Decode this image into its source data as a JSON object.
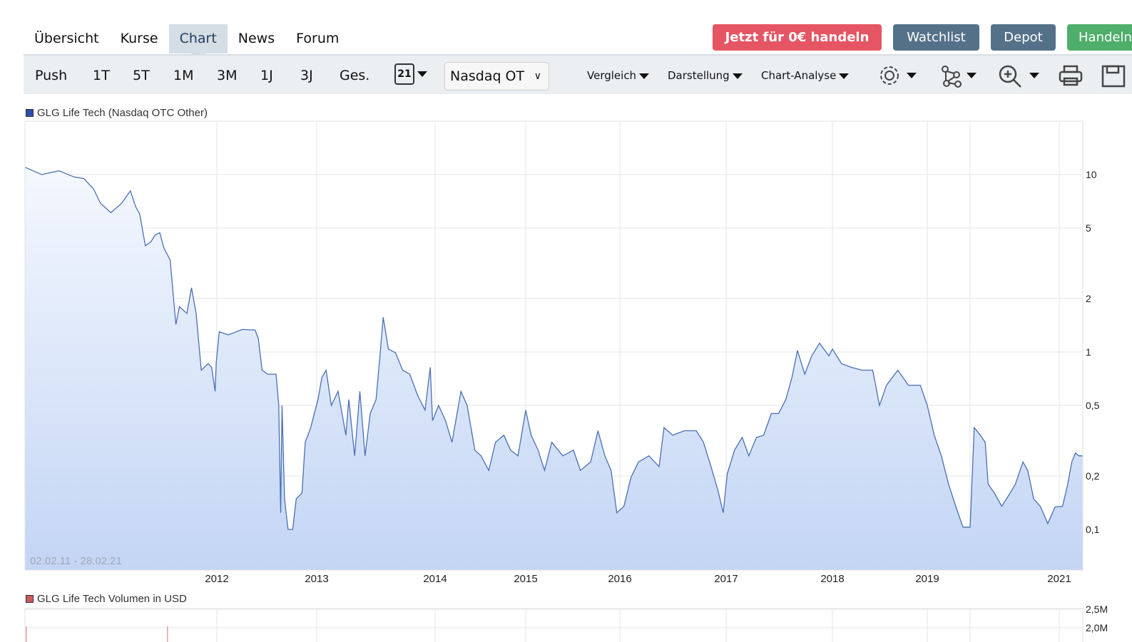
{
  "nav": {
    "tabs": [
      {
        "label": "Übersicht"
      },
      {
        "label": "Kurse"
      },
      {
        "label": "Chart",
        "active": true
      },
      {
        "label": "News"
      },
      {
        "label": "Forum"
      }
    ]
  },
  "actions": {
    "trade": "Jetzt für 0€ handeln",
    "watchlist": "Watchlist",
    "depot": "Depot",
    "handeln": "Handeln"
  },
  "colors": {
    "trade": "#e55563",
    "watchlist": "#55718a",
    "handeln": "#4eae6a",
    "line": "#4a6fb5",
    "fill_top": "#f4f8fe",
    "fill_bottom": "#c3d5f4",
    "volume": "#c85a5a"
  },
  "toolbar": {
    "ranges": [
      "Push",
      "1T",
      "5T",
      "1M",
      "3M",
      "1J",
      "3J",
      "Ges."
    ],
    "calendar_day": "21",
    "exchange": "Nasdaq OTC Other",
    "exchange_visible": "Nasdaq OT",
    "menus": [
      "Vergleich",
      "Darstellung",
      "Chart-Analyse"
    ],
    "icons": [
      "gear-icon",
      "network-icon",
      "zoom-in-icon",
      "print-icon",
      "save-icon"
    ]
  },
  "chart_data": [
    {
      "type": "area",
      "legend": "GLG Life Tech (Nasdaq OTC Other)",
      "date_range": "02.02.11 - 28.02.21",
      "y_scale": "log",
      "ylim": [
        0.078,
        16
      ],
      "y_ticks": [
        {
          "v": 10,
          "label": "10"
        },
        {
          "v": 5,
          "label": "5"
        },
        {
          "v": 2,
          "label": "2"
        },
        {
          "v": 1,
          "label": "1"
        },
        {
          "v": 0.5,
          "label": "0,5"
        },
        {
          "v": 0.2,
          "label": "0,2"
        },
        {
          "v": 0.1,
          "label": "0,1"
        }
      ],
      "x_ticks": [
        {
          "d": "2012-01-01",
          "label": "2012"
        },
        {
          "d": "2013-01-01",
          "label": "2013"
        },
        {
          "d": "2014-01-01",
          "label": "2014"
        },
        {
          "d": "2015-01-01",
          "label": "2015"
        },
        {
          "d": "2016-01-01",
          "label": "2016"
        },
        {
          "d": "2017-01-01",
          "label": "2017"
        },
        {
          "d": "2018-01-01",
          "label": "2018"
        },
        {
          "d": "2019-01-01",
          "label": "2019"
        },
        {
          "d": "2020-01-01",
          "label": ""
        },
        {
          "d": "2021-01-01",
          "label": "2021"
        }
      ],
      "grid": true,
      "points": [
        [
          "2011-02-02",
          11.0
        ],
        [
          "2011-03-03",
          10.0
        ],
        [
          "2011-04-02",
          10.5
        ],
        [
          "2011-04-28",
          9.7
        ],
        [
          "2011-05-15",
          9.5
        ],
        [
          "2011-06-01",
          8.3
        ],
        [
          "2011-06-13",
          6.9
        ],
        [
          "2011-07-01",
          6.1
        ],
        [
          "2011-07-20",
          6.9
        ],
        [
          "2011-08-04",
          8.1
        ],
        [
          "2011-08-13",
          6.6
        ],
        [
          "2011-08-20",
          6.0
        ],
        [
          "2011-08-30",
          3.97
        ],
        [
          "2011-09-08",
          4.16
        ],
        [
          "2011-09-16",
          4.56
        ],
        [
          "2011-09-24",
          4.7
        ],
        [
          "2011-10-01",
          3.86
        ],
        [
          "2011-10-12",
          3.3
        ],
        [
          "2011-10-18",
          1.98
        ],
        [
          "2011-10-22",
          1.43
        ],
        [
          "2011-10-28",
          1.8
        ],
        [
          "2011-11-10",
          1.65
        ],
        [
          "2011-11-18",
          2.3
        ],
        [
          "2011-11-26",
          1.65
        ],
        [
          "2011-12-05",
          0.79
        ],
        [
          "2011-12-17",
          0.86
        ],
        [
          "2011-12-23",
          0.82
        ],
        [
          "2011-12-29",
          0.6
        ],
        [
          "2011-12-31",
          0.88
        ],
        [
          "2012-01-10",
          1.3
        ],
        [
          "2012-02-12",
          1.25
        ],
        [
          "2012-04-03",
          1.34
        ],
        [
          "2012-05-20",
          1.33
        ],
        [
          "2012-06-01",
          1.19
        ],
        [
          "2012-06-15",
          0.79
        ],
        [
          "2012-07-05",
          0.75
        ],
        [
          "2012-08-05",
          0.75
        ],
        [
          "2012-08-15",
          0.5
        ],
        [
          "2012-08-22",
          0.124
        ],
        [
          "2012-08-27",
          0.5
        ],
        [
          "2012-09-05",
          0.149
        ],
        [
          "2012-09-18",
          0.1
        ],
        [
          "2012-10-05",
          0.1
        ],
        [
          "2012-10-18",
          0.149
        ],
        [
          "2012-11-08",
          0.16
        ],
        [
          "2012-11-20",
          0.31
        ],
        [
          "2012-12-10",
          0.375
        ],
        [
          "2013-01-05",
          0.54
        ],
        [
          "2013-01-17",
          0.72
        ],
        [
          "2013-01-30",
          0.79
        ],
        [
          "2013-02-15",
          0.5
        ],
        [
          "2013-03-08",
          0.6
        ],
        [
          "2013-04-01",
          0.34
        ],
        [
          "2013-04-10",
          0.54
        ],
        [
          "2013-04-28",
          0.26
        ],
        [
          "2013-05-14",
          0.6
        ],
        [
          "2013-05-30",
          0.26
        ],
        [
          "2013-06-15",
          0.45
        ],
        [
          "2013-07-03",
          0.54
        ],
        [
          "2013-07-15",
          0.95
        ],
        [
          "2013-07-25",
          1.57
        ],
        [
          "2013-08-10",
          1.04
        ],
        [
          "2013-09-01",
          0.99
        ],
        [
          "2013-09-23",
          0.79
        ],
        [
          "2013-10-15",
          0.75
        ],
        [
          "2013-11-08",
          0.57
        ],
        [
          "2013-12-01",
          0.47
        ],
        [
          "2013-12-17",
          0.82
        ],
        [
          "2013-12-24",
          0.41
        ],
        [
          "2014-01-15",
          0.5
        ],
        [
          "2014-02-12",
          0.41
        ],
        [
          "2014-03-10",
          0.31
        ],
        [
          "2014-04-15",
          0.6
        ],
        [
          "2014-05-10",
          0.5
        ],
        [
          "2014-06-10",
          0.28
        ],
        [
          "2014-07-05",
          0.26
        ],
        [
          "2014-08-05",
          0.215
        ],
        [
          "2014-09-01",
          0.31
        ],
        [
          "2014-10-05",
          0.34
        ],
        [
          "2014-11-01",
          0.28
        ],
        [
          "2014-12-01",
          0.26
        ],
        [
          "2015-01-01",
          0.47
        ],
        [
          "2015-01-22",
          0.34
        ],
        [
          "2015-02-18",
          0.28
        ],
        [
          "2015-03-15",
          0.215
        ],
        [
          "2015-04-12",
          0.31
        ],
        [
          "2015-05-25",
          0.26
        ],
        [
          "2015-07-05",
          0.28
        ],
        [
          "2015-08-01",
          0.215
        ],
        [
          "2015-09-10",
          0.24
        ],
        [
          "2015-10-08",
          0.36
        ],
        [
          "2015-11-04",
          0.26
        ],
        [
          "2015-11-28",
          0.215
        ],
        [
          "2015-12-20",
          0.124
        ],
        [
          "2016-01-15",
          0.135
        ],
        [
          "2016-02-08",
          0.196
        ],
        [
          "2016-03-05",
          0.24
        ],
        [
          "2016-04-10",
          0.26
        ],
        [
          "2016-05-15",
          0.226
        ],
        [
          "2016-06-01",
          0.375
        ],
        [
          "2016-07-01",
          0.34
        ],
        [
          "2016-08-10",
          0.36
        ],
        [
          "2016-09-20",
          0.36
        ],
        [
          "2016-10-15",
          0.31
        ],
        [
          "2016-11-10",
          0.226
        ],
        [
          "2016-12-05",
          0.163
        ],
        [
          "2016-12-22",
          0.124
        ],
        [
          "2017-01-05",
          0.206
        ],
        [
          "2017-01-30",
          0.28
        ],
        [
          "2017-02-25",
          0.33
        ],
        [
          "2017-03-20",
          0.26
        ],
        [
          "2017-04-15",
          0.33
        ],
        [
          "2017-05-10",
          0.34
        ],
        [
          "2017-06-05",
          0.45
        ],
        [
          "2017-06-30",
          0.45
        ],
        [
          "2017-07-25",
          0.54
        ],
        [
          "2017-08-15",
          0.72
        ],
        [
          "2017-09-03",
          1.02
        ],
        [
          "2017-09-28",
          0.75
        ],
        [
          "2017-10-22",
          0.95
        ],
        [
          "2017-11-18",
          1.12
        ],
        [
          "2017-12-20",
          0.95
        ],
        [
          "2018-01-01",
          1.04
        ],
        [
          "2018-02-05",
          0.86
        ],
        [
          "2018-03-15",
          0.82
        ],
        [
          "2018-04-25",
          0.79
        ],
        [
          "2018-06-05",
          0.79
        ],
        [
          "2018-07-01",
          0.5
        ],
        [
          "2018-07-28",
          0.65
        ],
        [
          "2018-09-10",
          0.79
        ],
        [
          "2018-10-20",
          0.65
        ],
        [
          "2018-12-05",
          0.65
        ],
        [
          "2019-01-01",
          0.5
        ],
        [
          "2019-03-01",
          0.34
        ],
        [
          "2019-05-01",
          0.26
        ],
        [
          "2019-07-01",
          0.18
        ],
        [
          "2019-09-01",
          0.135
        ],
        [
          "2019-11-01",
          0.103
        ],
        [
          "2020-01-01",
          0.103
        ],
        [
          "2020-01-18",
          0.375
        ],
        [
          "2020-02-12",
          0.34
        ],
        [
          "2020-03-03",
          0.31
        ],
        [
          "2020-03-15",
          0.18
        ],
        [
          "2020-04-10",
          0.16
        ],
        [
          "2020-05-10",
          0.135
        ],
        [
          "2020-06-08",
          0.156
        ],
        [
          "2020-07-05",
          0.18
        ],
        [
          "2020-08-05",
          0.24
        ],
        [
          "2020-08-25",
          0.215
        ],
        [
          "2020-09-18",
          0.149
        ],
        [
          "2020-10-15",
          0.135
        ],
        [
          "2020-11-15",
          0.108
        ],
        [
          "2020-12-15",
          0.134
        ],
        [
          "2021-01-09",
          0.135
        ],
        [
          "2021-01-22",
          0.18
        ],
        [
          "2021-02-01",
          0.24
        ],
        [
          "2021-02-10",
          0.27
        ],
        [
          "2021-02-18",
          0.26
        ],
        [
          "2021-02-28",
          0.26
        ]
      ]
    },
    {
      "type": "bar",
      "legend": "GLG Life Tech Volumen in USD",
      "y_ticks": [
        {
          "v": 2500000,
          "label": "2,5M"
        },
        {
          "v": 2000000,
          "label": "2,0M"
        }
      ]
    }
  ]
}
